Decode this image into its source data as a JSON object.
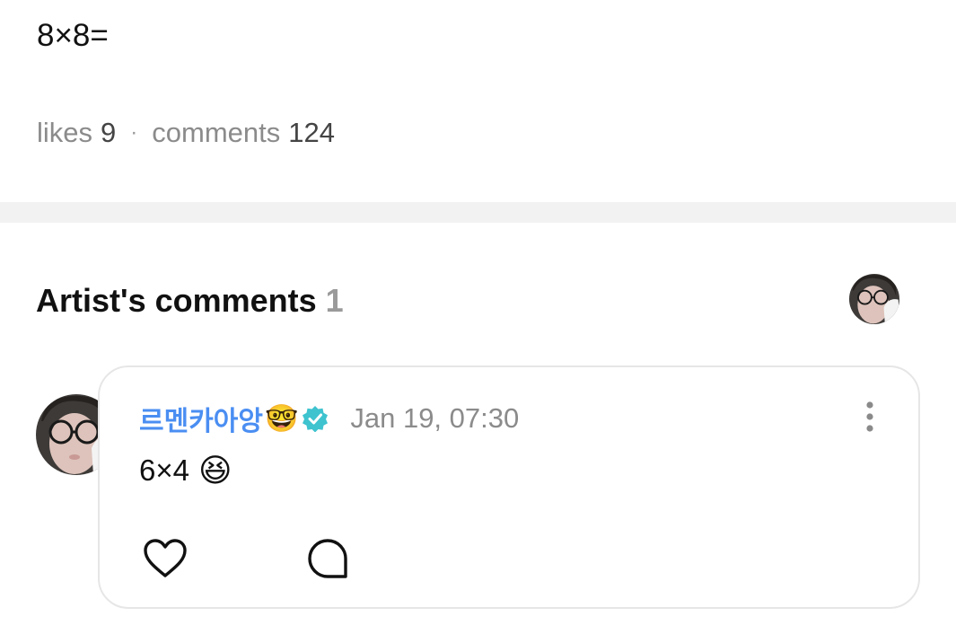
{
  "post": {
    "text": "8×8=",
    "likes_label": "likes",
    "likes_count": "9",
    "separator": "·",
    "comments_label": "comments",
    "comments_count": "124"
  },
  "artist_comments": {
    "title": "Artist's comments",
    "count": "1",
    "comments": [
      {
        "author": "르멘카아앙",
        "author_emoji": "🤓",
        "verified": true,
        "timestamp": "Jan 19, 07:30",
        "body": "6×4",
        "body_emoji": "😆"
      }
    ]
  },
  "icons": {
    "verified": "verified-badge-icon",
    "more": "more-vertical-icon",
    "like": "heart-icon",
    "reply": "comment-bubble-icon"
  },
  "colors": {
    "author_name": "#4a8ef2",
    "verified_badge": "#3ec3cf",
    "muted_text": "#8b8b8b",
    "divider": "#f2f2f2",
    "card_border": "#e6e6e6"
  }
}
